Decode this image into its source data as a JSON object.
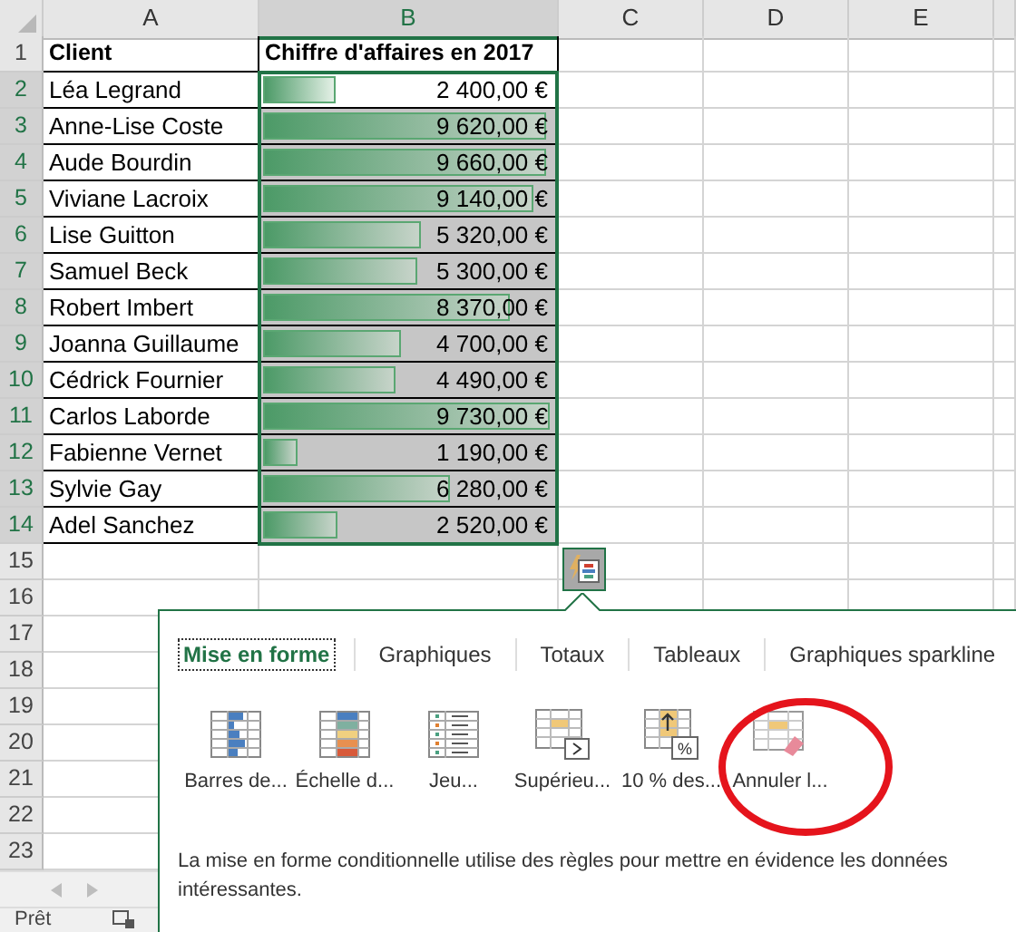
{
  "columns": [
    {
      "label": "A",
      "selected": false
    },
    {
      "label": "B",
      "selected": true
    },
    {
      "label": "C",
      "selected": false
    },
    {
      "label": "D",
      "selected": false
    },
    {
      "label": "E",
      "selected": false
    }
  ],
  "row_numbers": [
    {
      "label": "1",
      "selected": false
    },
    {
      "label": "2",
      "selected": true
    },
    {
      "label": "3",
      "selected": true
    },
    {
      "label": "4",
      "selected": true
    },
    {
      "label": "5",
      "selected": true
    },
    {
      "label": "6",
      "selected": true
    },
    {
      "label": "7",
      "selected": true
    },
    {
      "label": "8",
      "selected": true
    },
    {
      "label": "9",
      "selected": true
    },
    {
      "label": "10",
      "selected": true
    },
    {
      "label": "11",
      "selected": true
    },
    {
      "label": "12",
      "selected": true
    },
    {
      "label": "13",
      "selected": true
    },
    {
      "label": "14",
      "selected": true
    },
    {
      "label": "15",
      "selected": false
    },
    {
      "label": "16",
      "selected": false
    },
    {
      "label": "17",
      "selected": false
    },
    {
      "label": "18",
      "selected": false
    },
    {
      "label": "19",
      "selected": false
    },
    {
      "label": "20",
      "selected": false
    },
    {
      "label": "21",
      "selected": false
    },
    {
      "label": "22",
      "selected": false
    },
    {
      "label": "23",
      "selected": false
    }
  ],
  "header": {
    "client": "Client",
    "revenue": "Chiffre d'affaires en 2017"
  },
  "rows": [
    {
      "client": "Léa Legrand",
      "amount": "2 400,00 €",
      "level": 0.25
    },
    {
      "client": "Anne-Lise Coste",
      "amount": "9 620,00 €",
      "level": 0.99
    },
    {
      "client": "Aude Bourdin",
      "amount": "9 660,00 €",
      "level": 0.99
    },
    {
      "client": "Viviane Lacroix",
      "amount": "9 140,00 €",
      "level": 0.94
    },
    {
      "client": "Lise Guitton",
      "amount": "5 320,00 €",
      "level": 0.55
    },
    {
      "client": "Samuel Beck",
      "amount": "5 300,00 €",
      "level": 0.54
    },
    {
      "client": "Robert Imbert",
      "amount": "8 370,00 €",
      "level": 0.86
    },
    {
      "client": "Joanna Guillaume",
      "amount": "4 700,00 €",
      "level": 0.48
    },
    {
      "client": "Cédrick Fournier",
      "amount": "4 490,00 €",
      "level": 0.46
    },
    {
      "client": "Carlos Laborde",
      "amount": "9 730,00 €",
      "level": 1
    },
    {
      "client": "Fabienne Vernet",
      "amount": "1 190,00 €",
      "level": 0.12
    },
    {
      "client": "Sylvie Gay",
      "amount": "6 280,00 €",
      "level": 0.65
    },
    {
      "client": "Adel Sanchez",
      "amount": "2 520,00 €",
      "level": 0.26
    }
  ],
  "quick_analysis": {
    "tabs": [
      {
        "label": "Mise en forme",
        "selected": true
      },
      {
        "label": "Graphiques",
        "selected": false
      },
      {
        "label": "Totaux",
        "selected": false
      },
      {
        "label": "Tableaux",
        "selected": false
      },
      {
        "label": "Graphiques sparkline",
        "selected": false
      }
    ],
    "tools": [
      {
        "label": "Barres de...",
        "kind": "data-bars"
      },
      {
        "label": "Échelle d...",
        "kind": "color-scale"
      },
      {
        "label": "Jeu...",
        "kind": "icon-set"
      },
      {
        "label": "Supérieu...",
        "kind": "greater-than"
      },
      {
        "label": "10 % des...",
        "kind": "top-ten",
        "badge": "%"
      },
      {
        "label": "Annuler l...",
        "kind": "clear"
      }
    ],
    "description": "La mise en forme conditionnelle utilise des règles pour mettre en évidence les données intéressantes."
  },
  "status_bar": {
    "text": "Prêt"
  }
}
